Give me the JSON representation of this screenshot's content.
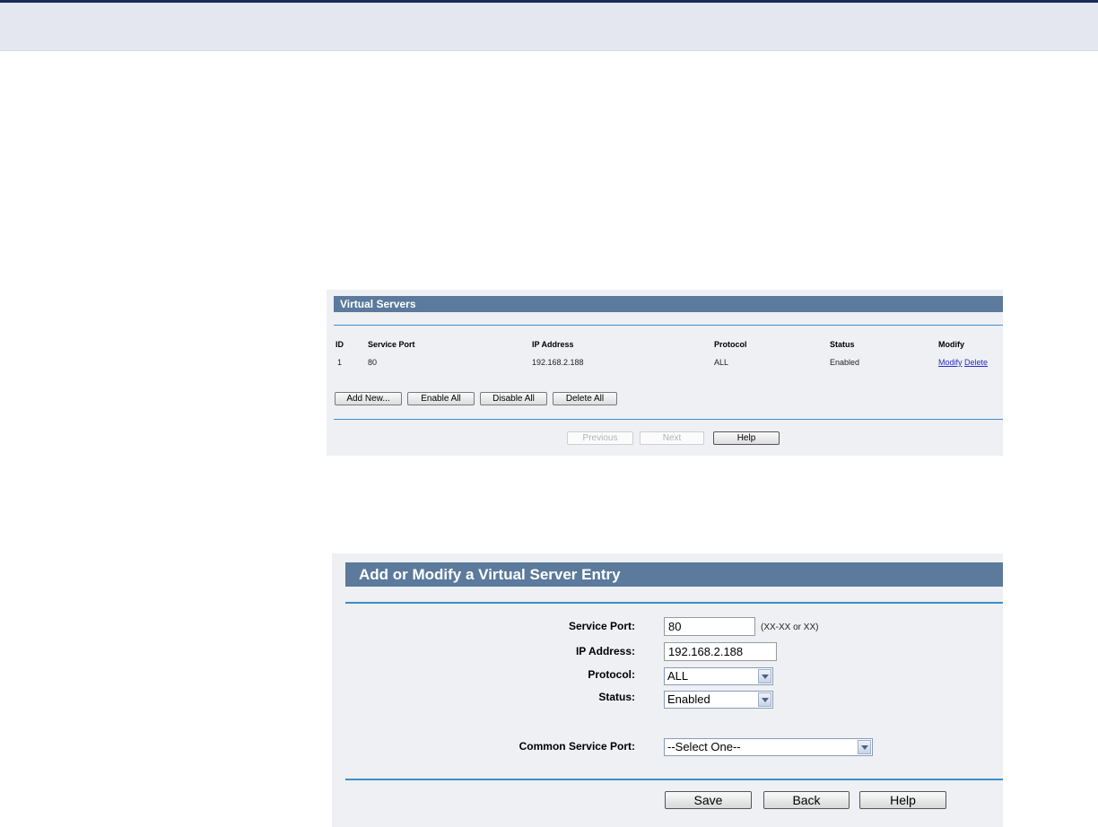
{
  "virtual_servers": {
    "title": "Virtual Servers",
    "columns": [
      "ID",
      "Service Port",
      "IP Address",
      "Protocol",
      "Status",
      "Modify"
    ],
    "rows": [
      {
        "id": "1",
        "service_port": "80",
        "ip_address": "192.168.2.188",
        "protocol": "ALL",
        "status": "Enabled",
        "modify_link": "Modify",
        "delete_link": "Delete"
      }
    ],
    "buttons": {
      "add_new": "Add New...",
      "enable_all": "Enable All",
      "disable_all": "Disable All",
      "delete_all": "Delete All"
    },
    "nav": {
      "previous": "Previous",
      "next": "Next",
      "help": "Help"
    }
  },
  "entry_form": {
    "title": "Add or Modify a Virtual Server Entry",
    "service_port": {
      "label": "Service Port:",
      "value": "80",
      "hint": "(XX-XX or XX)"
    },
    "ip_address": {
      "label": "IP Address:",
      "value": "192.168.2.188"
    },
    "protocol": {
      "label": "Protocol:",
      "selected": "ALL"
    },
    "status": {
      "label": "Status:",
      "selected": "Enabled"
    },
    "common_service_port": {
      "label": "Common Service Port:",
      "selected": "--Select One--"
    },
    "buttons": {
      "save": "Save",
      "back": "Back",
      "help": "Help"
    }
  },
  "colors": {
    "title_bar": "#5b7a9c",
    "rule": "#3e8ec9",
    "panel_bg": "#eef0f3",
    "header_bg": "#e4e7f0",
    "top_bar": "#1b2a55",
    "link": "#2c2cc7"
  }
}
